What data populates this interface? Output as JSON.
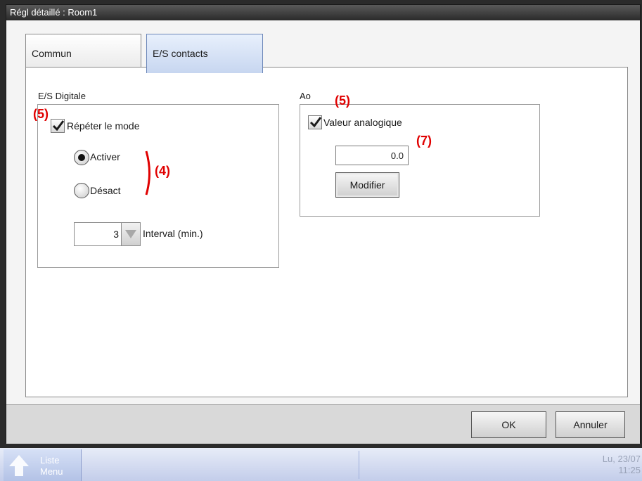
{
  "window": {
    "title": "Régl détaillé : Room1"
  },
  "tabs": [
    {
      "label": "Commun",
      "active": false
    },
    {
      "label": "E/S contacts",
      "active": true
    }
  ],
  "digital_io": {
    "group_label": "E/S Digitale",
    "repeat_mode": {
      "label": "Répéter le mode",
      "checked": true
    },
    "radio_options": [
      {
        "label": "Activer",
        "selected": true
      },
      {
        "label": "Désact",
        "selected": false
      }
    ],
    "interval": {
      "value": "3",
      "label": "Interval (min.)"
    }
  },
  "analog_out": {
    "group_label": "Ao",
    "analog_value": {
      "label": "Valeur analogique",
      "checked": true
    },
    "value": "0.0",
    "modify_button": "Modifier"
  },
  "annotations": {
    "five_left": "(5)",
    "five_right": "(5)",
    "four": "(4)",
    "seven": "(7)"
  },
  "footer": {
    "ok_button": "OK",
    "cancel_button": "Annuler"
  },
  "taskbar": {
    "home_line1": "Liste",
    "home_line2": "Menu",
    "date": "Lu, 23/07",
    "time": "11:25"
  },
  "colors": {
    "annotation": "#e00000",
    "active_tab": "#c7d6f0",
    "taskbar": "#c3cdea"
  }
}
